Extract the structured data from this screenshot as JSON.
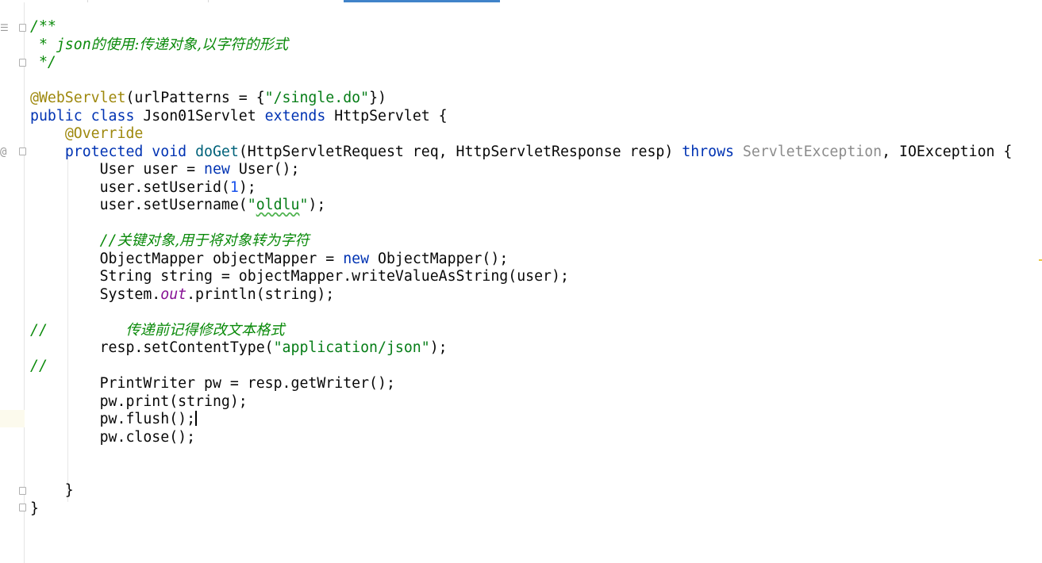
{
  "editor": {
    "language": "java",
    "lines": [
      {
        "segs": [
          {
            "t": "/**",
            "c": "doc"
          }
        ]
      },
      {
        "segs": [
          {
            "t": " * json",
            "c": "doc"
          },
          {
            "t": "的使用:传递对象,以字符的形式",
            "c": "doc cjk"
          }
        ]
      },
      {
        "segs": [
          {
            "t": " */",
            "c": "doc"
          }
        ]
      },
      {
        "segs": []
      },
      {
        "segs": [
          {
            "t": "@WebServlet",
            "c": "ann"
          },
          {
            "t": "(urlPatterns = {"
          },
          {
            "t": "\"/single.do\"",
            "c": "str"
          },
          {
            "t": "})"
          }
        ]
      },
      {
        "segs": [
          {
            "t": "public class ",
            "c": "kw"
          },
          {
            "t": "Json01Servlet "
          },
          {
            "t": "extends ",
            "c": "kw"
          },
          {
            "t": "HttpServlet {"
          }
        ]
      },
      {
        "segs": [
          {
            "t": "    "
          },
          {
            "t": "@Override",
            "c": "ann"
          }
        ]
      },
      {
        "segs": [
          {
            "t": "    "
          },
          {
            "t": "protected void ",
            "c": "kw"
          },
          {
            "t": "doGet",
            "c": "method-decl"
          },
          {
            "t": "(HttpServletRequest req, HttpServletResponse resp) "
          },
          {
            "t": "throws ",
            "c": "kw"
          },
          {
            "t": "ServletException",
            "c": "unused"
          },
          {
            "t": ", IOException {"
          }
        ]
      },
      {
        "segs": [
          {
            "t": "        User user = "
          },
          {
            "t": "new ",
            "c": "kw"
          },
          {
            "t": "User();"
          }
        ]
      },
      {
        "segs": [
          {
            "t": "        user.setUserid("
          },
          {
            "t": "1",
            "c": "num"
          },
          {
            "t": ");"
          }
        ]
      },
      {
        "segs": [
          {
            "t": "        user.setUsername("
          },
          {
            "t": "\"",
            "c": "str"
          },
          {
            "t": "oldlu",
            "c": "str typo"
          },
          {
            "t": "\"",
            "c": "str"
          },
          {
            "t": ");"
          }
        ]
      },
      {
        "segs": []
      },
      {
        "segs": [
          {
            "t": "        "
          },
          {
            "t": "//",
            "c": "cmt"
          },
          {
            "t": "关键对象,用于将对象转为字符",
            "c": "cmt cjk"
          }
        ]
      },
      {
        "segs": [
          {
            "t": "        ObjectMapper objectMapper = "
          },
          {
            "t": "new ",
            "c": "kw"
          },
          {
            "t": "ObjectMapper();"
          }
        ]
      },
      {
        "segs": [
          {
            "t": "        String string = objectMapper.writeValueAsString(user);"
          }
        ]
      },
      {
        "segs": [
          {
            "t": "        System."
          },
          {
            "t": "out",
            "c": "static-field"
          },
          {
            "t": ".println(string);"
          }
        ]
      },
      {
        "segs": []
      },
      {
        "segs": [
          {
            "t": "//         ",
            "c": "cmt"
          },
          {
            "t": "传递前记得修改文本格式",
            "c": "cmt cjk"
          }
        ]
      },
      {
        "segs": [
          {
            "t": "        resp.setContentType("
          },
          {
            "t": "\"application/json\"",
            "c": "str"
          },
          {
            "t": ");"
          }
        ]
      },
      {
        "segs": [
          {
            "t": "//",
            "c": "cmt"
          }
        ]
      },
      {
        "segs": [
          {
            "t": "        PrintWriter pw = resp.getWriter();"
          }
        ]
      },
      {
        "segs": [
          {
            "t": "        pw.print(string);"
          }
        ]
      },
      {
        "segs": [
          {
            "t": "        pw.flush();"
          },
          {
            "caret": true
          }
        ]
      },
      {
        "segs": [
          {
            "t": "        pw.close();"
          }
        ]
      },
      {
        "segs": []
      },
      {
        "segs": []
      },
      {
        "segs": [
          {
            "t": "    }"
          }
        ]
      },
      {
        "segs": [
          {
            "t": "}"
          }
        ]
      }
    ]
  },
  "gutter": {
    "structure_icon": "structure-icon",
    "override_marker": "@",
    "override_icon": "override-method-icon"
  },
  "colors": {
    "keyword": "#0033b3",
    "annotation": "#9e880d",
    "string": "#067d17",
    "number": "#1750eb",
    "comment": "#0a8a0a",
    "unused": "#8c8c8c",
    "static_field": "#871094",
    "method_declaration": "#00627a",
    "active_tab_indicator": "#4083c9",
    "caret_row": "#fcfaed"
  }
}
